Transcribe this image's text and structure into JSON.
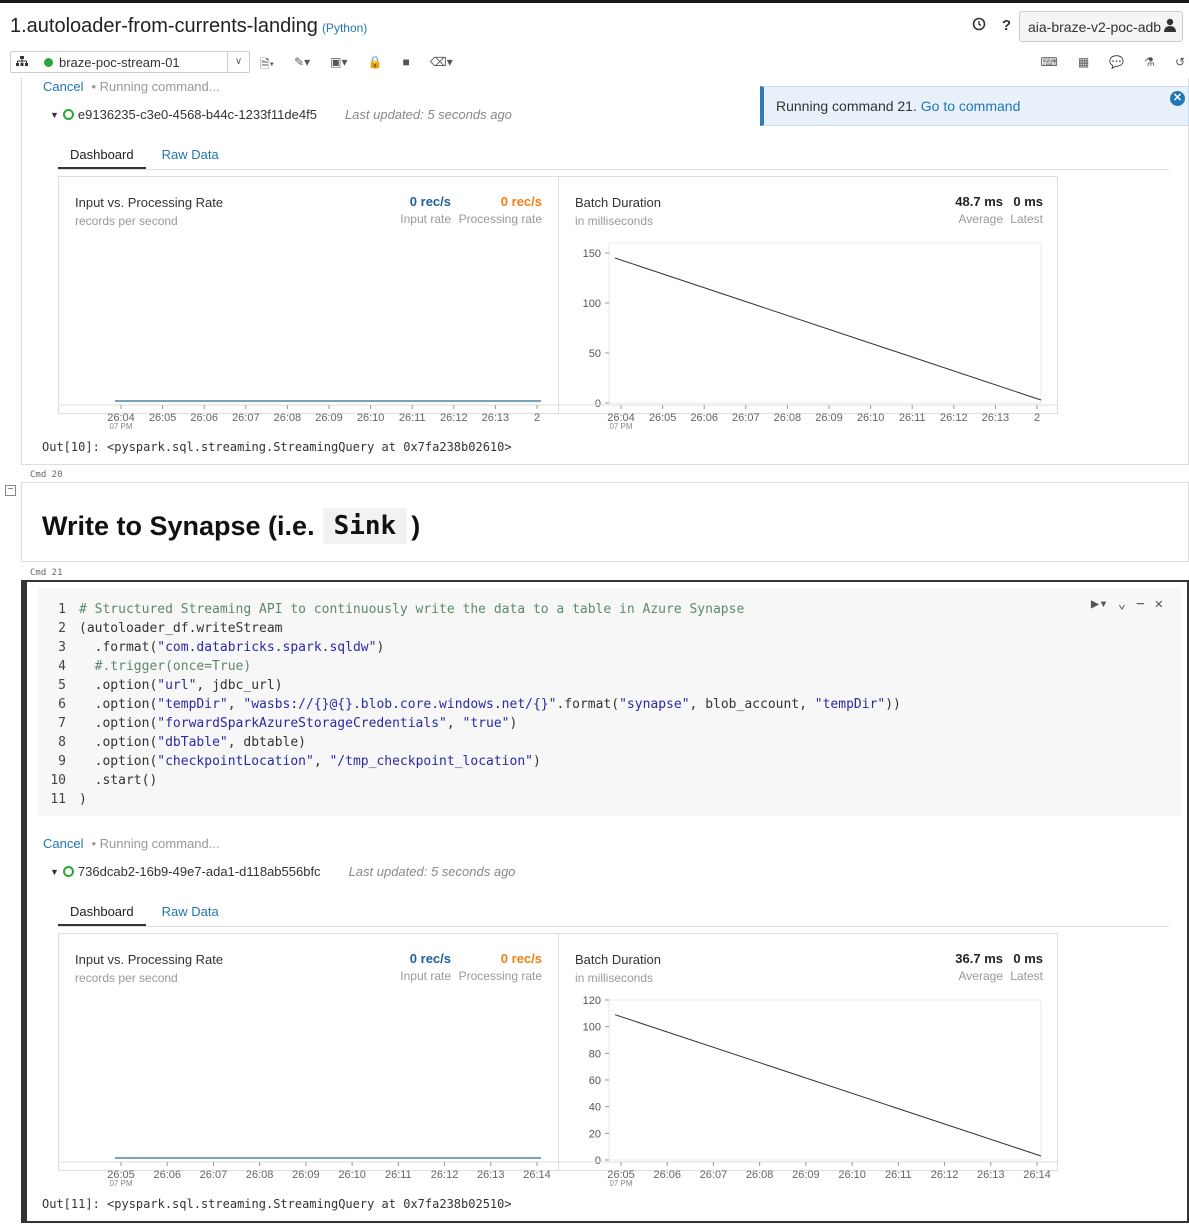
{
  "notebook": {
    "title": "1.autoloader-from-currents-landing",
    "language": "(Python)"
  },
  "header": {
    "user": "aia-braze-v2-poc-adb",
    "clock_icon": "clock-icon",
    "help_icon": "help-icon"
  },
  "toolbar": {
    "cluster": "braze-poc-stream-01"
  },
  "notification": {
    "text": "Running command 21.",
    "link": "Go to command"
  },
  "cell19": {
    "cancel": "Cancel",
    "running": "Running command...",
    "query_id": "e9136235-c3e0-4568-b44c-1233f11de4f5",
    "last_updated": "Last updated: 5 seconds ago",
    "tabs": [
      "Dashboard",
      "Raw Data"
    ],
    "rate_panel": {
      "title": "Input vs. Processing Rate",
      "subtitle": "records per second",
      "input_value": "0 rec/s",
      "input_label": "Input rate",
      "proc_value": "0 rec/s",
      "proc_label": "Processing rate"
    },
    "batch_panel": {
      "title": "Batch Duration",
      "subtitle": "in milliseconds",
      "avg_value": "48.7 ms",
      "avg_label": "Average",
      "latest_value": "0 ms",
      "latest_label": "Latest"
    },
    "output": "Out[10]: <pyspark.sql.streaming.StreamingQuery at 0x7fa238b02610>"
  },
  "cmd20": {
    "label": "Cmd 20",
    "heading_pre": "Write to Synapse (i.e.",
    "heading_code": "Sink",
    "heading_post": ")"
  },
  "cmd21": {
    "label": "Cmd 21",
    "line_numbers": [
      "1",
      "2",
      "3",
      "4",
      "5",
      "6",
      "7",
      "8",
      "9",
      "10",
      "11"
    ],
    "cancel": "Cancel",
    "running": "Running command...",
    "query_id": "736dcab2-16b9-49e7-ada1-d118ab556bfc",
    "last_updated": "Last updated: 5 seconds ago",
    "tabs": [
      "Dashboard",
      "Raw Data"
    ],
    "rate_panel": {
      "title": "Input vs. Processing Rate",
      "subtitle": "records per second",
      "input_value": "0 rec/s",
      "input_label": "Input rate",
      "proc_value": "0 rec/s",
      "proc_label": "Processing rate"
    },
    "batch_panel": {
      "title": "Batch Duration",
      "subtitle": "in milliseconds",
      "avg_value": "36.7 ms",
      "avg_label": "Average",
      "latest_value": "0 ms",
      "latest_label": "Latest"
    },
    "output": "Out[11]: <pyspark.sql.streaming.StreamingQuery at 0x7fa238b02510>"
  },
  "chart_data": [
    {
      "type": "line",
      "title": "Input vs. Processing Rate",
      "x": [
        "26:04",
        "26:05",
        "26:06",
        "26:07",
        "26:08",
        "26:09",
        "26:10",
        "26:11",
        "26:12",
        "26:13",
        "2"
      ],
      "x_sublabel": "07 PM",
      "series": [
        {
          "values": [
            0,
            0
          ]
        }
      ],
      "color": "#2c6e8a"
    },
    {
      "type": "line",
      "title": "Batch Duration",
      "x": [
        "26:04",
        "26:05",
        "26:06",
        "26:07",
        "26:08",
        "26:09",
        "26:10",
        "26:11",
        "26:12",
        "26:13",
        "2"
      ],
      "x_sublabel": "07 PM",
      "yticks": [
        0,
        50,
        100,
        150
      ],
      "ylim": [
        0,
        160
      ],
      "series": [
        {
          "values": [
            145,
            3
          ]
        }
      ],
      "color": "#333333"
    },
    {
      "type": "line",
      "title": "Input vs. Processing Rate",
      "x": [
        "26:05",
        "26:06",
        "26:07",
        "26:08",
        "26:09",
        "26:10",
        "26:11",
        "26:12",
        "26:13",
        "26:14"
      ],
      "x_sublabel": "07 PM",
      "series": [
        {
          "values": [
            0,
            0
          ]
        }
      ],
      "color": "#2c6e8a"
    },
    {
      "type": "line",
      "title": "Batch Duration",
      "x": [
        "26:05",
        "26:06",
        "26:07",
        "26:08",
        "26:09",
        "26:10",
        "26:11",
        "26:12",
        "26:13",
        "26:14"
      ],
      "x_sublabel": "07 PM",
      "yticks": [
        0,
        20,
        40,
        60,
        80,
        100,
        120
      ],
      "ylim": [
        0,
        120
      ],
      "series": [
        {
          "values": [
            109,
            3
          ]
        }
      ],
      "color": "#333333"
    }
  ],
  "code": [
    [
      {
        "t": "# Structured Streaming API to continuously write the data to a table in Azure Synapse",
        "c": "com"
      }
    ],
    [
      {
        "t": "(autoloader_df.writeStream",
        "c": ""
      }
    ],
    [
      {
        "t": "  .format(",
        "c": ""
      },
      {
        "t": "\"com.databricks.spark.sqldw\"",
        "c": "str"
      },
      {
        "t": ")",
        "c": ""
      }
    ],
    [
      {
        "t": "  #.trigger(once=True)",
        "c": "com"
      }
    ],
    [
      {
        "t": "  .option(",
        "c": ""
      },
      {
        "t": "\"url\"",
        "c": "str"
      },
      {
        "t": ", jdbc_url)",
        "c": ""
      }
    ],
    [
      {
        "t": "  .option(",
        "c": ""
      },
      {
        "t": "\"tempDir\"",
        "c": "str"
      },
      {
        "t": ", ",
        "c": ""
      },
      {
        "t": "\"wasbs://{}@{}.blob.core.windows.net/{}\"",
        "c": "str"
      },
      {
        "t": ".format(",
        "c": ""
      },
      {
        "t": "\"synapse\"",
        "c": "str"
      },
      {
        "t": ", blob_account, ",
        "c": ""
      },
      {
        "t": "\"tempDir\"",
        "c": "str"
      },
      {
        "t": "))",
        "c": ""
      }
    ],
    [
      {
        "t": "  .option(",
        "c": ""
      },
      {
        "t": "\"forwardSparkAzureStorageCredentials\"",
        "c": "str"
      },
      {
        "t": ", ",
        "c": ""
      },
      {
        "t": "\"true\"",
        "c": "str"
      },
      {
        "t": ")",
        "c": ""
      }
    ],
    [
      {
        "t": "  .option(",
        "c": ""
      },
      {
        "t": "\"dbTable\"",
        "c": "str"
      },
      {
        "t": ", dbtable)",
        "c": ""
      }
    ],
    [
      {
        "t": "  .option(",
        "c": ""
      },
      {
        "t": "\"checkpointLocation\"",
        "c": "str"
      },
      {
        "t": ", ",
        "c": ""
      },
      {
        "t": "\"/tmp_checkpoint_location\"",
        "c": "str"
      },
      {
        "t": ")",
        "c": ""
      }
    ],
    [
      {
        "t": "  .start()",
        "c": ""
      }
    ],
    [
      {
        "t": ")",
        "c": ""
      }
    ]
  ]
}
